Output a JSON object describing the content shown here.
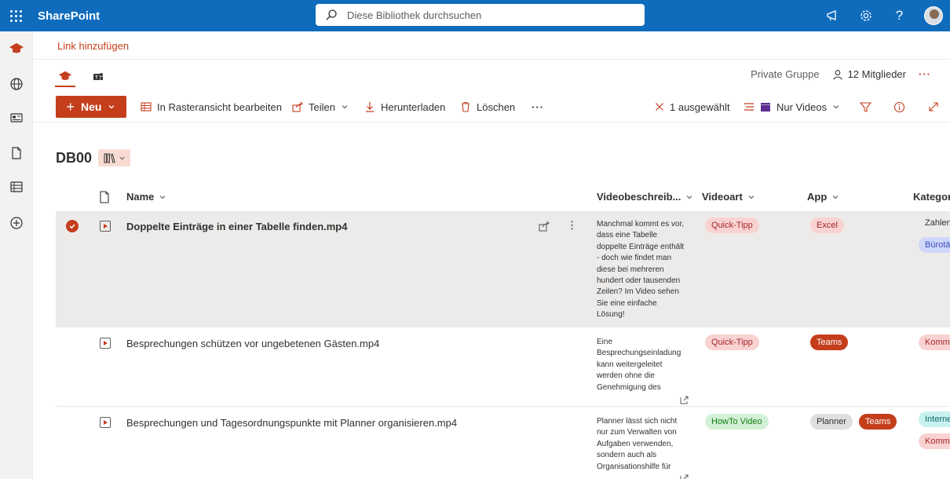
{
  "app": {
    "brand": "SharePoint"
  },
  "search": {
    "placeholder": "Diese Bibliothek durchsuchen"
  },
  "linkbar": {
    "add_link": "Link hinzufügen"
  },
  "site": {
    "privacy": "Private Gruppe",
    "members": "12 Mitglieder"
  },
  "commands": {
    "new": "Neu",
    "grid_edit": "In Rasteransicht bearbeiten",
    "share": "Teilen",
    "download": "Herunterladen",
    "delete": "Löschen",
    "selected": "1 ausgewählt",
    "view": "Nur Videos"
  },
  "library": {
    "title": "DB00"
  },
  "columns": {
    "name": "Name",
    "description": "Videobeschreib...",
    "videoart": "Videoart",
    "app": "App",
    "category": "Kategor"
  },
  "rows": [
    {
      "name": "Doppelte Einträge in einer Tabelle finden.mp4",
      "description": "Manchmal kommt es vor, dass eine Tabelle doppelte Einträge enthält - doch wie findet man diese bei mehreren hundert oder tausenden Zeilen? Im Video sehen Sie eine einfache Lösung!",
      "videoart": "Quick-Tipp",
      "apps": [
        "Excel"
      ],
      "categories": [
        "Zahlen",
        "Bürotät"
      ],
      "selected": true
    },
    {
      "name": "Besprechungen schützen vor ungebetenen Gästen.mp4",
      "description": "Eine Besprechungseinladung kann weitergeleitet werden ohne die Genehmigung des",
      "videoart": "Quick-Tipp",
      "apps": [
        "Teams"
      ],
      "categories": [
        "Kommu"
      ],
      "selected": false
    },
    {
      "name": "Besprechungen und Tagesordnungspunkte mit Planner organisieren.mp4",
      "description": "Planner lässt sich nicht nur zum Verwalten von Aufgaben verwenden, sondern auch als Organisationshilfe für",
      "videoart": "HowTo Video",
      "apps": [
        "Planner",
        "Teams"
      ],
      "categories": [
        "Interne",
        "Kommu"
      ],
      "selected": false
    }
  ],
  "colors": {
    "topbar": "#0f6cbd",
    "accent": "#c43e1c"
  }
}
